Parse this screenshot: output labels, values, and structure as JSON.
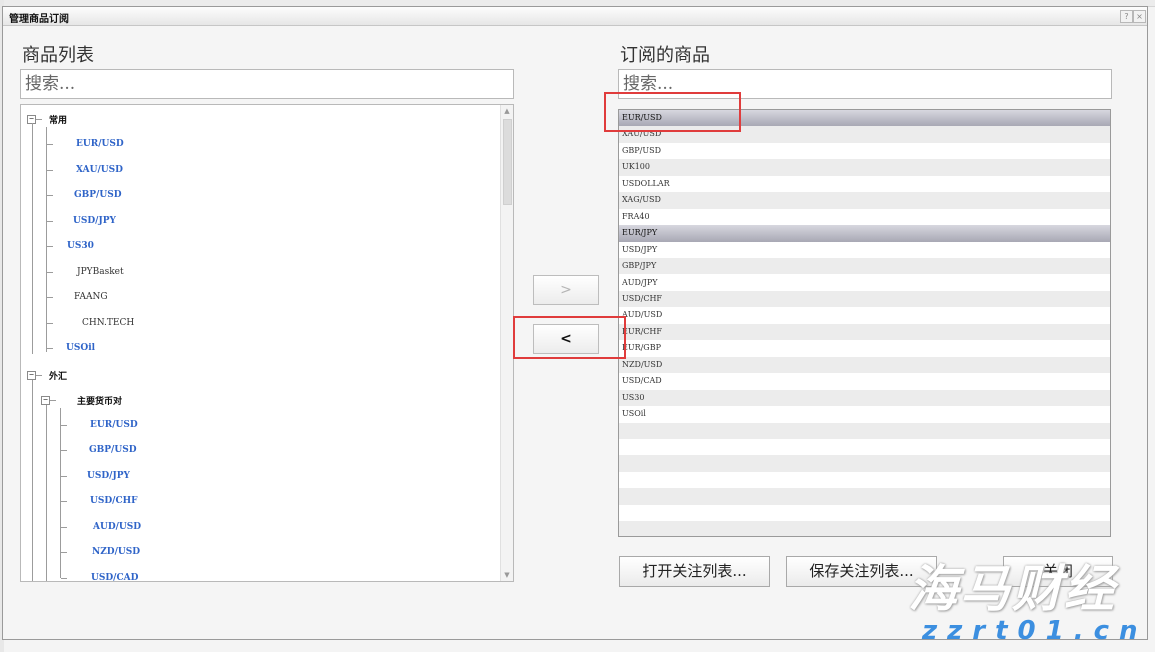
{
  "window": {
    "title": "管理商品订阅",
    "help_label": "?",
    "close_label": "×"
  },
  "left_panel": {
    "title": "商品列表",
    "search_placeholder": "搜索..."
  },
  "right_panel": {
    "title": "订阅的商品",
    "search_placeholder": "搜索..."
  },
  "tree": {
    "group_common": "常用",
    "common_items": [
      "EUR/USD",
      "XAU/USD",
      "GBP/USD",
      "USD/JPY",
      "US30",
      "JPYBasket",
      "FAANG",
      "CHN.TECH",
      "USOil"
    ],
    "group_fx": "外汇",
    "subgroup_major": "主要货币对",
    "major_items": [
      "EUR/USD",
      "GBP/USD",
      "USD/JPY",
      "USD/CHF",
      "AUD/USD",
      "NZD/USD",
      "USD/CAD"
    ]
  },
  "buttons": {
    "add": ">",
    "remove": "<",
    "open_watchlist": "打开关注列表...",
    "save_watchlist": "保存关注列表...",
    "close": "关闭"
  },
  "subscribed": [
    "EUR/USD",
    "XAU/USD",
    "GBP/USD",
    "UK100",
    "USDOLLAR",
    "XAG/USD",
    "FRA40",
    "EUR/JPY",
    "USD/JPY",
    "GBP/JPY",
    "AUD/JPY",
    "USD/CHF",
    "AUD/USD",
    "EUR/CHF",
    "EUR/GBP",
    "NZD/USD",
    "USD/CAD",
    "US30",
    "USOil"
  ],
  "watermark": {
    "text": "海马财经",
    "url": "zzrt01.cn"
  }
}
